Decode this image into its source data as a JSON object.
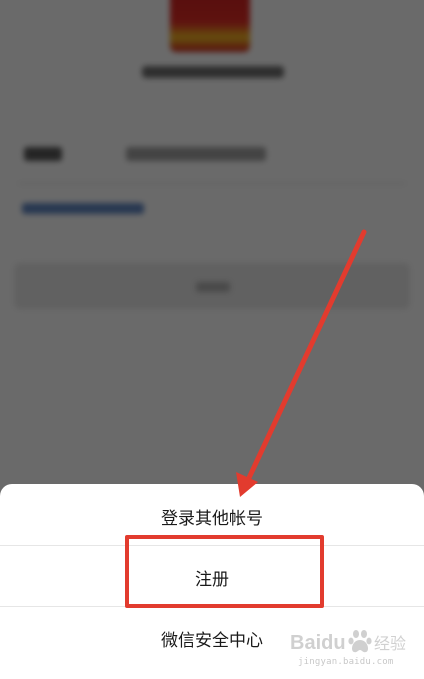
{
  "action_sheet": {
    "items": [
      {
        "label": "登录其他帐号"
      },
      {
        "label": "注册"
      },
      {
        "label": "微信安全中心"
      }
    ]
  },
  "annotation": {
    "color": "#e23b2e",
    "highlight_target": "注册"
  },
  "watermark": {
    "brand": "Baidu",
    "product": "经验",
    "url": "jingyan.baidu.com"
  },
  "colors": {
    "overlay": "rgba(0,0,0,0.56)",
    "sheet_background": "#ffffff",
    "text": "#1a1a1a",
    "annotation_red": "#e23b2e"
  }
}
